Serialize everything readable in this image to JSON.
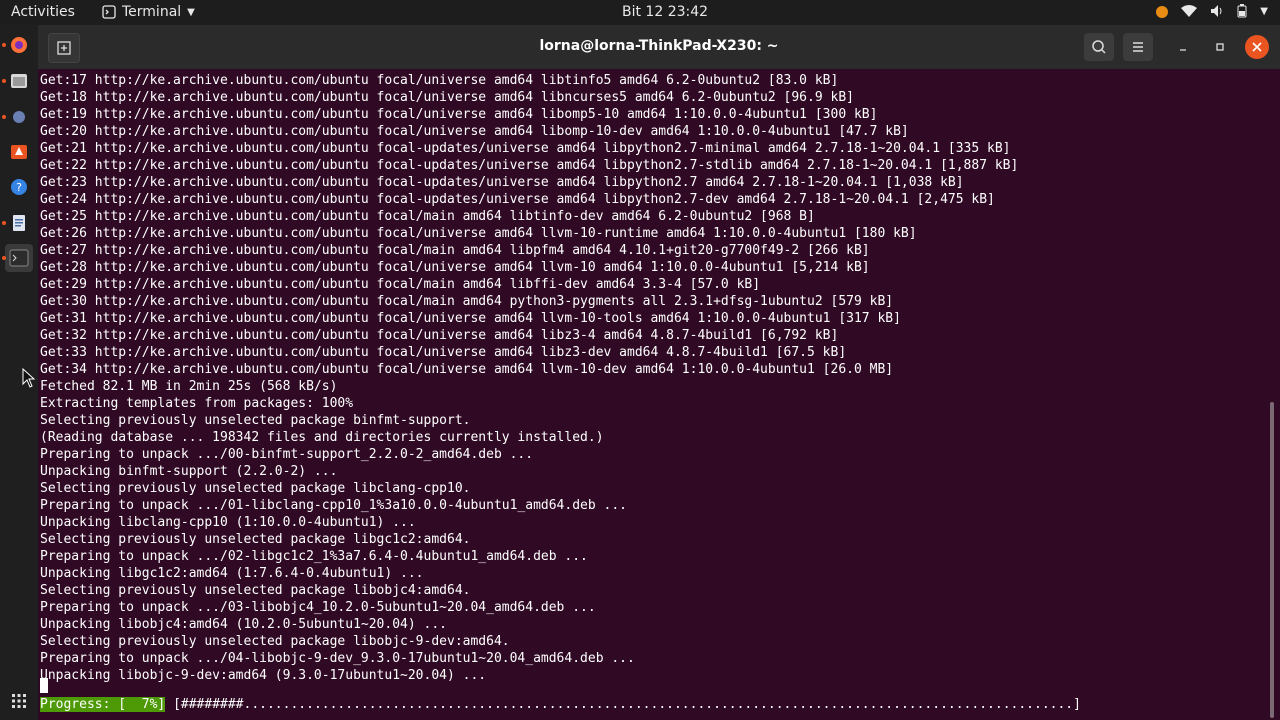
{
  "topbar": {
    "activities": "Activities",
    "app_name": "Terminal",
    "clock": "Bit 12  23:42"
  },
  "window": {
    "title": "lorna@lorna-ThinkPad-X230: ~"
  },
  "terminal": {
    "lines": [
      "Get:17 http://ke.archive.ubuntu.com/ubuntu focal/universe amd64 libtinfo5 amd64 6.2-0ubuntu2 [83.0 kB]",
      "Get:18 http://ke.archive.ubuntu.com/ubuntu focal/universe amd64 libncurses5 amd64 6.2-0ubuntu2 [96.9 kB]",
      "Get:19 http://ke.archive.ubuntu.com/ubuntu focal/universe amd64 libomp5-10 amd64 1:10.0.0-4ubuntu1 [300 kB]",
      "Get:20 http://ke.archive.ubuntu.com/ubuntu focal/universe amd64 libomp-10-dev amd64 1:10.0.0-4ubuntu1 [47.7 kB]",
      "Get:21 http://ke.archive.ubuntu.com/ubuntu focal-updates/universe amd64 libpython2.7-minimal amd64 2.7.18-1~20.04.1 [335 kB]",
      "Get:22 http://ke.archive.ubuntu.com/ubuntu focal-updates/universe amd64 libpython2.7-stdlib amd64 2.7.18-1~20.04.1 [1,887 kB]",
      "Get:23 http://ke.archive.ubuntu.com/ubuntu focal-updates/universe amd64 libpython2.7 amd64 2.7.18-1~20.04.1 [1,038 kB]",
      "Get:24 http://ke.archive.ubuntu.com/ubuntu focal-updates/universe amd64 libpython2.7-dev amd64 2.7.18-1~20.04.1 [2,475 kB]",
      "Get:25 http://ke.archive.ubuntu.com/ubuntu focal/main amd64 libtinfo-dev amd64 6.2-0ubuntu2 [968 B]",
      "Get:26 http://ke.archive.ubuntu.com/ubuntu focal/universe amd64 llvm-10-runtime amd64 1:10.0.0-4ubuntu1 [180 kB]",
      "Get:27 http://ke.archive.ubuntu.com/ubuntu focal/main amd64 libpfm4 amd64 4.10.1+git20-g7700f49-2 [266 kB]",
      "Get:28 http://ke.archive.ubuntu.com/ubuntu focal/universe amd64 llvm-10 amd64 1:10.0.0-4ubuntu1 [5,214 kB]",
      "Get:29 http://ke.archive.ubuntu.com/ubuntu focal/main amd64 libffi-dev amd64 3.3-4 [57.0 kB]",
      "Get:30 http://ke.archive.ubuntu.com/ubuntu focal/main amd64 python3-pygments all 2.3.1+dfsg-1ubuntu2 [579 kB]",
      "Get:31 http://ke.archive.ubuntu.com/ubuntu focal/universe amd64 llvm-10-tools amd64 1:10.0.0-4ubuntu1 [317 kB]",
      "Get:32 http://ke.archive.ubuntu.com/ubuntu focal/universe amd64 libz3-4 amd64 4.8.7-4build1 [6,792 kB]",
      "Get:33 http://ke.archive.ubuntu.com/ubuntu focal/universe amd64 libz3-dev amd64 4.8.7-4build1 [67.5 kB]",
      "Get:34 http://ke.archive.ubuntu.com/ubuntu focal/universe amd64 llvm-10-dev amd64 1:10.0.0-4ubuntu1 [26.0 MB]",
      "Fetched 82.1 MB in 2min 25s (568 kB/s)",
      "Extracting templates from packages: 100%",
      "Selecting previously unselected package binfmt-support.",
      "(Reading database ... 198342 files and directories currently installed.)",
      "Preparing to unpack .../00-binfmt-support_2.2.0-2_amd64.deb ...",
      "Unpacking binfmt-support (2.2.0-2) ...",
      "Selecting previously unselected package libclang-cpp10.",
      "Preparing to unpack .../01-libclang-cpp10_1%3a10.0.0-4ubuntu1_amd64.deb ...",
      "Unpacking libclang-cpp10 (1:10.0.0-4ubuntu1) ...",
      "Selecting previously unselected package libgc1c2:amd64.",
      "Preparing to unpack .../02-libgc1c2_1%3a7.6.4-0.4ubuntu1_amd64.deb ...",
      "Unpacking libgc1c2:amd64 (1:7.6.4-0.4ubuntu1) ...",
      "Selecting previously unselected package libobjc4:amd64.",
      "Preparing to unpack .../03-libobjc4_10.2.0-5ubuntu1~20.04_amd64.deb ...",
      "Unpacking libobjc4:amd64 (10.2.0-5ubuntu1~20.04) ...",
      "Selecting previously unselected package libobjc-9-dev:amd64.",
      "Preparing to unpack .../04-libobjc-9-dev_9.3.0-17ubuntu1~20.04_amd64.deb ...",
      "Unpacking libobjc-9-dev:amd64 (9.3.0-17ubuntu1~20.04) ..."
    ],
    "progress_label": "Progress: [  7%]",
    "progress_bar": "[########..........................................................................................................]",
    "progress_percent": 7
  },
  "colors": {
    "terminal_bg": "#300a24",
    "progress_green": "#4e9a06",
    "accent": "#e95420"
  }
}
